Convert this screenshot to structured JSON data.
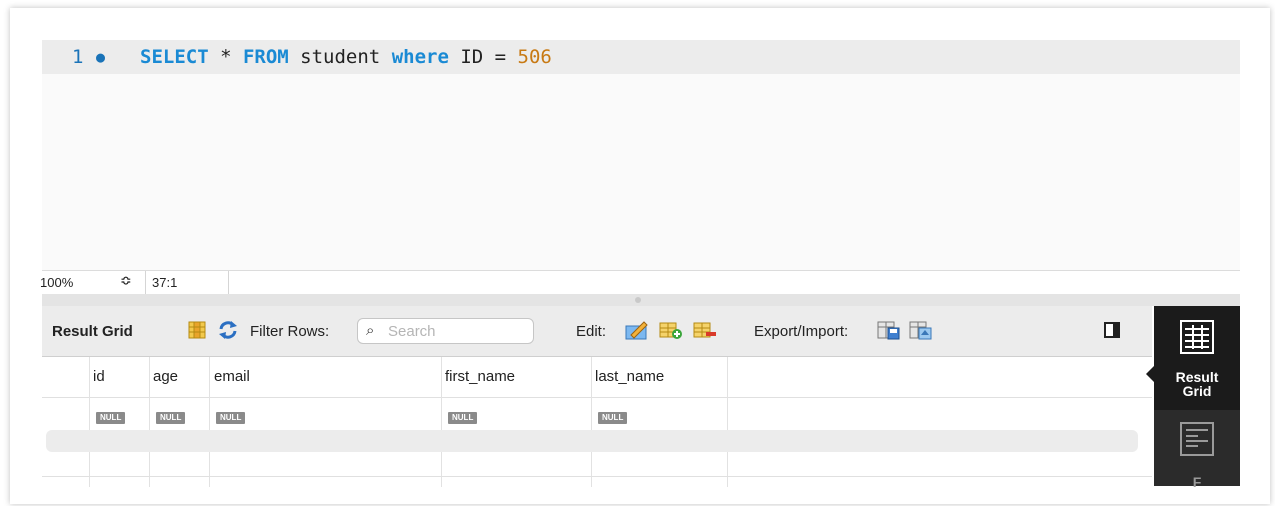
{
  "editor": {
    "line_number": "1",
    "line_marker": "●",
    "sql": {
      "select": "SELECT",
      "star": " * ",
      "from": "FROM",
      "table": " student ",
      "where": "where",
      "condition": " ID = ",
      "value": "506"
    }
  },
  "status": {
    "zoom": "100%",
    "zoom_arrows": "≎",
    "cursor_position": "37:1"
  },
  "toolbar": {
    "result_grid_label": "Result Grid",
    "filter_rows_label": "Filter Rows:",
    "search_placeholder": "Search",
    "edit_label": "Edit:",
    "export_import_label": "Export/Import:"
  },
  "grid": {
    "columns": [
      "id",
      "age",
      "email",
      "first_name",
      "last_name"
    ],
    "rows": [
      [
        "NULL",
        "NULL",
        "NULL",
        "NULL",
        "NULL"
      ]
    ]
  },
  "side_panel": {
    "active_label_line1": "Result",
    "active_label_line2": "Grid",
    "next_label": "F"
  },
  "colors": {
    "keyword": "#1a8ad4",
    "number": "#c87a14",
    "line_number": "#1a73b8",
    "side_panel_bg": "#2b2b2b"
  }
}
